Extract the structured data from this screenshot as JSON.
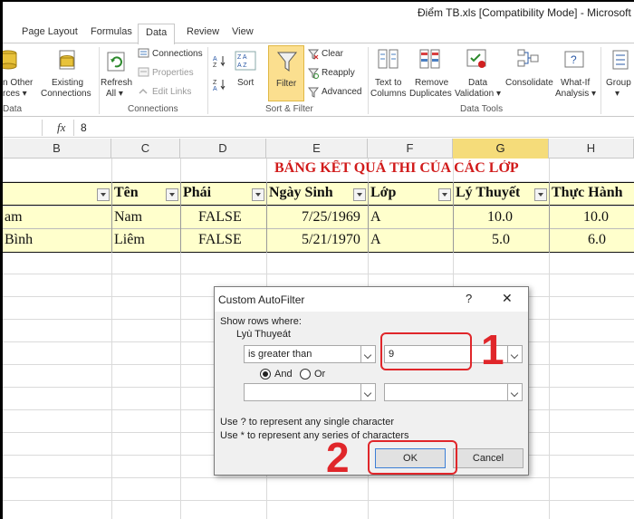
{
  "window": {
    "title": "Điểm TB.xls  [Compatibility Mode]  -  Microsoft"
  },
  "tabs": [
    "Page Layout",
    "Formulas",
    "Data",
    "Review",
    "View"
  ],
  "active_tab": "Data",
  "ribbon": {
    "get_external": {
      "from_other_line1": "n Other",
      "from_other_line2": "rces ▾",
      "existing_line1": "Existing",
      "existing_line2": "Connections",
      "group_label": "Data"
    },
    "connections": {
      "refresh_line1": "Refresh",
      "refresh_line2": "All ▾",
      "connections": "Connections",
      "properties": "Properties",
      "edit_links": "Edit Links",
      "group_label": "Connections"
    },
    "sort_filter": {
      "sort": "Sort",
      "filter": "Filter",
      "clear": "Clear",
      "reapply": "Reapply",
      "advanced": "Advanced",
      "group_label": "Sort & Filter"
    },
    "data_tools": {
      "text_to_columns_line1": "Text to",
      "text_to_columns_line2": "Columns",
      "remove_dup_line1": "Remove",
      "remove_dup_line2": "Duplicates",
      "validation_line1": "Data",
      "validation_line2": "Validation ▾",
      "consolidate": "Consolidate",
      "whatif_line1": "What-If",
      "whatif_line2": "Analysis ▾",
      "group_label": "Data Tools"
    },
    "outline": {
      "group_line1": "Group",
      "group_line2": "▾"
    }
  },
  "formula_bar": {
    "fx": "fx",
    "value": "8"
  },
  "columns": [
    {
      "letter": "B"
    },
    {
      "letter": "C"
    },
    {
      "letter": "D"
    },
    {
      "letter": "E"
    },
    {
      "letter": "F"
    },
    {
      "letter": "G"
    },
    {
      "letter": "H"
    }
  ],
  "sheet": {
    "title": "BẢNG KẾT QUẢ THI CỦA CÁC LỚP",
    "headers": [
      "Tên",
      "Phái",
      "Ngày Sinh",
      "Lớp",
      "Lý Thuyết",
      "Thực Hành"
    ],
    "rows": [
      {
        "b": "am",
        "c": "Nam",
        "d": "FALSE",
        "e": "7/25/1969",
        "f": "A",
        "g": "10.0",
        "h": "10.0"
      },
      {
        "b": "Bình",
        "c": "Liêm",
        "d": "FALSE",
        "e": "5/21/1970",
        "f": "A",
        "g": "5.0",
        "h": "6.0"
      }
    ]
  },
  "dialog": {
    "title": "Custom AutoFilter",
    "help": "?",
    "close": "✕",
    "show_rows": "Show rows where:",
    "field": "Lyù Thuyeát",
    "operator1": "is greater than",
    "value1": "9",
    "and_label": "And",
    "or_label": "Or",
    "operator2": "",
    "value2": "",
    "hint1": "Use ? to represent any single character",
    "hint2": "Use * to represent any series of characters",
    "ok": "OK",
    "cancel": "Cancel"
  },
  "annotations": {
    "step1": "1",
    "step2": "2"
  },
  "colors": {
    "accent_red": "#e0262a",
    "header_yellow": "#ffffcc",
    "title_red": "#d11b1b"
  }
}
